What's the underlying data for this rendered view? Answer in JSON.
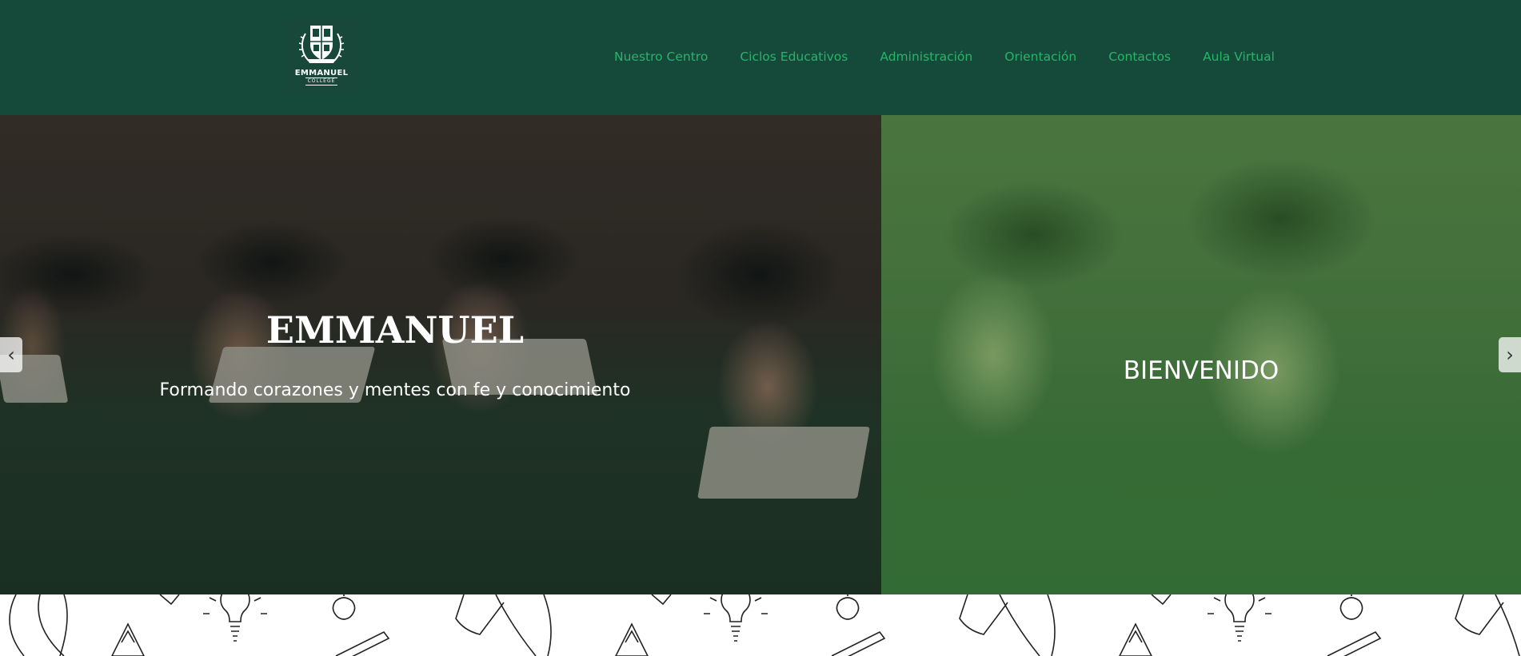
{
  "brand": {
    "name": "EMMANUEL",
    "sub": "COLLEGE",
    "logo_icon": "shield-crest-icon"
  },
  "nav": {
    "items": [
      {
        "label": "Nuestro Centro"
      },
      {
        "label": "Ciclos Educativos"
      },
      {
        "label": "Administración"
      },
      {
        "label": "Orientación"
      },
      {
        "label": "Contactos"
      },
      {
        "label": "Aula Virtual"
      }
    ]
  },
  "hero": {
    "title": "EMMANUEL",
    "subtitle": "Formando corazones y mentes con fe y conocimiento",
    "welcome": "BIENVENIDO",
    "prev_label": "‹",
    "next_label": "›"
  },
  "colors": {
    "header_bg": "#154a3a",
    "nav_link": "#29b36a",
    "overlay_green": "#3a6a36"
  }
}
